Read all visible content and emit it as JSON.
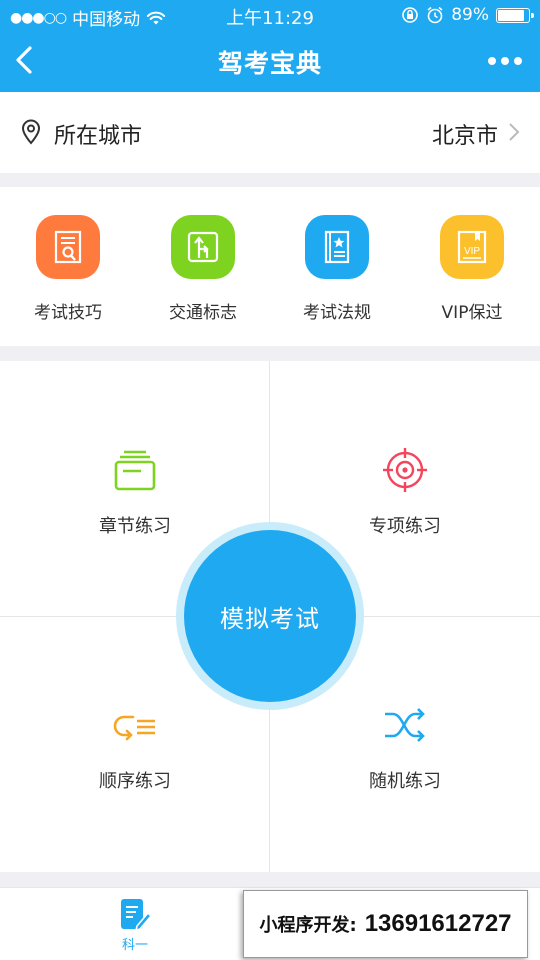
{
  "status_bar": {
    "signal_dots": "●●●○○",
    "carrier": "中国移动",
    "time": "上午11:29",
    "battery_percent": "89%",
    "battery_level": 0.89,
    "icons": [
      "wifi-icon",
      "rotation-lock-icon",
      "alarm-icon",
      "battery-icon"
    ]
  },
  "navbar": {
    "title": "驾考宝典",
    "icons": [
      "back-arrow-icon",
      "more-dots-icon"
    ]
  },
  "city": {
    "label": "所在城市",
    "value": "北京市",
    "icons": [
      "location-pin-icon",
      "chevron-right-icon"
    ]
  },
  "categories": [
    {
      "label": "考试技巧",
      "icon": "exam-tips-icon",
      "color": "#ff7a3d"
    },
    {
      "label": "交通标志",
      "icon": "traffic-sign-icon",
      "color": "#7ed321"
    },
    {
      "label": "考试法规",
      "icon": "regulations-book-icon",
      "color": "#1ea9f0"
    },
    {
      "label": "VIP保过",
      "icon": "vip-book-icon",
      "color": "#fcc02d"
    }
  ],
  "practice": {
    "items": [
      {
        "label": "章节练习",
        "icon": "chapter-stack-icon",
        "color": "#7ed321"
      },
      {
        "label": "专项练习",
        "icon": "target-crosshair-icon",
        "color": "#f5455c"
      },
      {
        "label": "顺序练习",
        "icon": "sequence-list-icon",
        "color": "#f5a623"
      },
      {
        "label": "随机练习",
        "icon": "shuffle-icon",
        "color": "#1ea9f0"
      }
    ],
    "exam_button": "模拟考试"
  },
  "tabbar": {
    "active_tab": "科一",
    "icon": "notebook-pen-icon"
  },
  "promo": {
    "label": "小程序开发:",
    "phone": "13691612727"
  },
  "colors": {
    "primary": "#1ea9f0",
    "background": "#efeff4"
  }
}
